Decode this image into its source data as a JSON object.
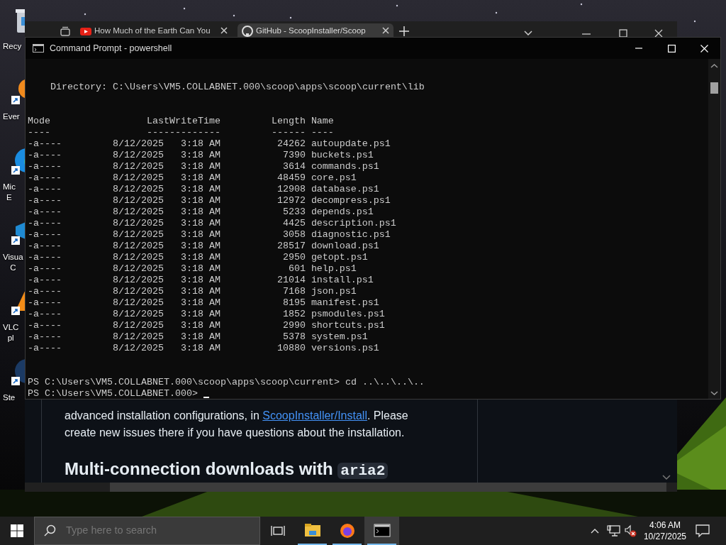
{
  "desktop_icons": [
    {
      "kind": "bin",
      "label_lines": [
        "Recy"
      ]
    },
    {
      "kind": "notes",
      "label_lines": [
        "Ever"
      ]
    },
    {
      "kind": "edge",
      "label_lines": [
        "Mic",
        "E"
      ]
    },
    {
      "kind": "code",
      "label_lines": [
        "Visua",
        "C"
      ]
    },
    {
      "kind": "cone",
      "label_lines": [
        "VLC",
        "pl"
      ]
    },
    {
      "kind": "steam",
      "label_lines": [
        "Ste"
      ]
    }
  ],
  "browser": {
    "tabs": [
      {
        "title": "How Much of the Earth Can You",
        "kind": "video",
        "selected": false
      },
      {
        "title": "GitHub - ScoopInstaller/Scoop",
        "kind": "repo",
        "selected": true
      }
    ],
    "article": {
      "before_link": "advanced installation configurations, in ",
      "link": "ScoopInstaller/Install",
      "after_link": ". Please create new issues there if you have questions about the installation.",
      "heading": "Multi-connection downloads with",
      "heading_code": "aria2"
    }
  },
  "terminal": {
    "title": "Command Prompt - powershell",
    "directory": "Directory: C:\\Users\\VM5.COLLABNET.000\\scoop\\apps\\scoop\\current\\lib",
    "columns": [
      {
        "label": "Mode",
        "rule": "----"
      },
      {
        "label": "LastWriteTime",
        "rule": "-------------"
      },
      {
        "label": "Length",
        "rule": "------"
      },
      {
        "label": "Name",
        "rule": "----"
      }
    ],
    "rows": [
      {
        "mode": "-a----",
        "date": "8/12/2025",
        "time": "3:18 AM",
        "length": "24262",
        "name": "autoupdate.ps1"
      },
      {
        "mode": "-a----",
        "date": "8/12/2025",
        "time": "3:18 AM",
        "length": "7390",
        "name": "buckets.ps1"
      },
      {
        "mode": "-a----",
        "date": "8/12/2025",
        "time": "3:18 AM",
        "length": "3614",
        "name": "commands.ps1"
      },
      {
        "mode": "-a----",
        "date": "8/12/2025",
        "time": "3:18 AM",
        "length": "48459",
        "name": "core.ps1"
      },
      {
        "mode": "-a----",
        "date": "8/12/2025",
        "time": "3:18 AM",
        "length": "12908",
        "name": "database.ps1"
      },
      {
        "mode": "-a----",
        "date": "8/12/2025",
        "time": "3:18 AM",
        "length": "12972",
        "name": "decompress.ps1"
      },
      {
        "mode": "-a----",
        "date": "8/12/2025",
        "time": "3:18 AM",
        "length": "5233",
        "name": "depends.ps1"
      },
      {
        "mode": "-a----",
        "date": "8/12/2025",
        "time": "3:18 AM",
        "length": "4425",
        "name": "description.ps1"
      },
      {
        "mode": "-a----",
        "date": "8/12/2025",
        "time": "3:18 AM",
        "length": "3058",
        "name": "diagnostic.ps1"
      },
      {
        "mode": "-a----",
        "date": "8/12/2025",
        "time": "3:18 AM",
        "length": "28517",
        "name": "download.ps1"
      },
      {
        "mode": "-a----",
        "date": "8/12/2025",
        "time": "3:18 AM",
        "length": "2950",
        "name": "getopt.ps1"
      },
      {
        "mode": "-a----",
        "date": "8/12/2025",
        "time": "3:18 AM",
        "length": "601",
        "name": "help.ps1"
      },
      {
        "mode": "-a----",
        "date": "8/12/2025",
        "time": "3:18 AM",
        "length": "21014",
        "name": "install.ps1"
      },
      {
        "mode": "-a----",
        "date": "8/12/2025",
        "time": "3:18 AM",
        "length": "7168",
        "name": "json.ps1"
      },
      {
        "mode": "-a----",
        "date": "8/12/2025",
        "time": "3:18 AM",
        "length": "8195",
        "name": "manifest.ps1"
      },
      {
        "mode": "-a----",
        "date": "8/12/2025",
        "time": "3:18 AM",
        "length": "1852",
        "name": "psmodules.ps1"
      },
      {
        "mode": "-a----",
        "date": "8/12/2025",
        "time": "3:18 AM",
        "length": "2990",
        "name": "shortcuts.ps1"
      },
      {
        "mode": "-a----",
        "date": "8/12/2025",
        "time": "3:18 AM",
        "length": "5378",
        "name": "system.ps1"
      },
      {
        "mode": "-a----",
        "date": "8/12/2025",
        "time": "3:18 AM",
        "length": "10880",
        "name": "versions.ps1"
      }
    ],
    "prompts": [
      "PS C:\\Users\\VM5.COLLABNET.000\\scoop\\apps\\scoop\\current> cd ..\\..\\..\\..",
      "PS C:\\Users\\VM5.COLLABNET.000>"
    ]
  },
  "taskbar": {
    "search": {
      "placeholder": "Type here to search"
    },
    "apps": [
      {
        "kind": "folder",
        "selected": false
      },
      {
        "kind": "browser",
        "selected": false
      },
      {
        "kind": "console",
        "selected": true
      }
    ],
    "time": "4:06 AM",
    "date": "10/27/2025"
  }
}
